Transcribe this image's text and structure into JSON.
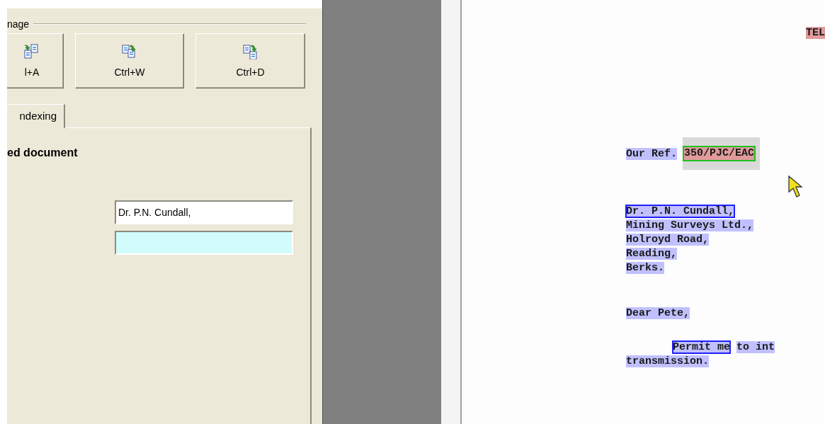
{
  "group": {
    "label": "nage"
  },
  "buttons": [
    {
      "label": "l+A"
    },
    {
      "label": "Ctrl+W"
    },
    {
      "label": "Ctrl+D"
    }
  ],
  "tabs": [
    {
      "label": "ndexing",
      "selected": true
    }
  ],
  "panel": {
    "heading": "ed document",
    "fields": [
      {
        "value": "Dr. P.N. Cundall,",
        "focused": false
      },
      {
        "focused": true
      }
    ]
  },
  "document": {
    "header": "TEL",
    "ref_label": "Our Ref.",
    "ref_value": "350/PJC/EAC",
    "paragraphs": [
      {
        "kind": "address",
        "lines": [
          [
            {
              "text": "Dr. P.N. Cundall,",
              "outlined": true
            }
          ],
          [
            {
              "text": "Mining Surveys Ltd.,",
              "outlined": false
            }
          ],
          [
            {
              "text": "Holroyd Road,",
              "outlined": false
            }
          ],
          [
            {
              "text": "Reading,",
              "outlined": false
            }
          ],
          [
            {
              "text": "Berks.",
              "outlined": false
            }
          ]
        ]
      },
      {
        "kind": "salutation",
        "lines": [
          [
            {
              "text": "Dear Pete,",
              "outlined": false
            }
          ]
        ]
      },
      {
        "kind": "body",
        "lines": [
          [
            {
              "text": "Permit me",
              "outlined": true
            },
            {
              "text": "to int",
              "outlined": false
            }
          ],
          [
            {
              "text": "transmission.",
              "outlined": false
            }
          ]
        ]
      }
    ]
  }
}
